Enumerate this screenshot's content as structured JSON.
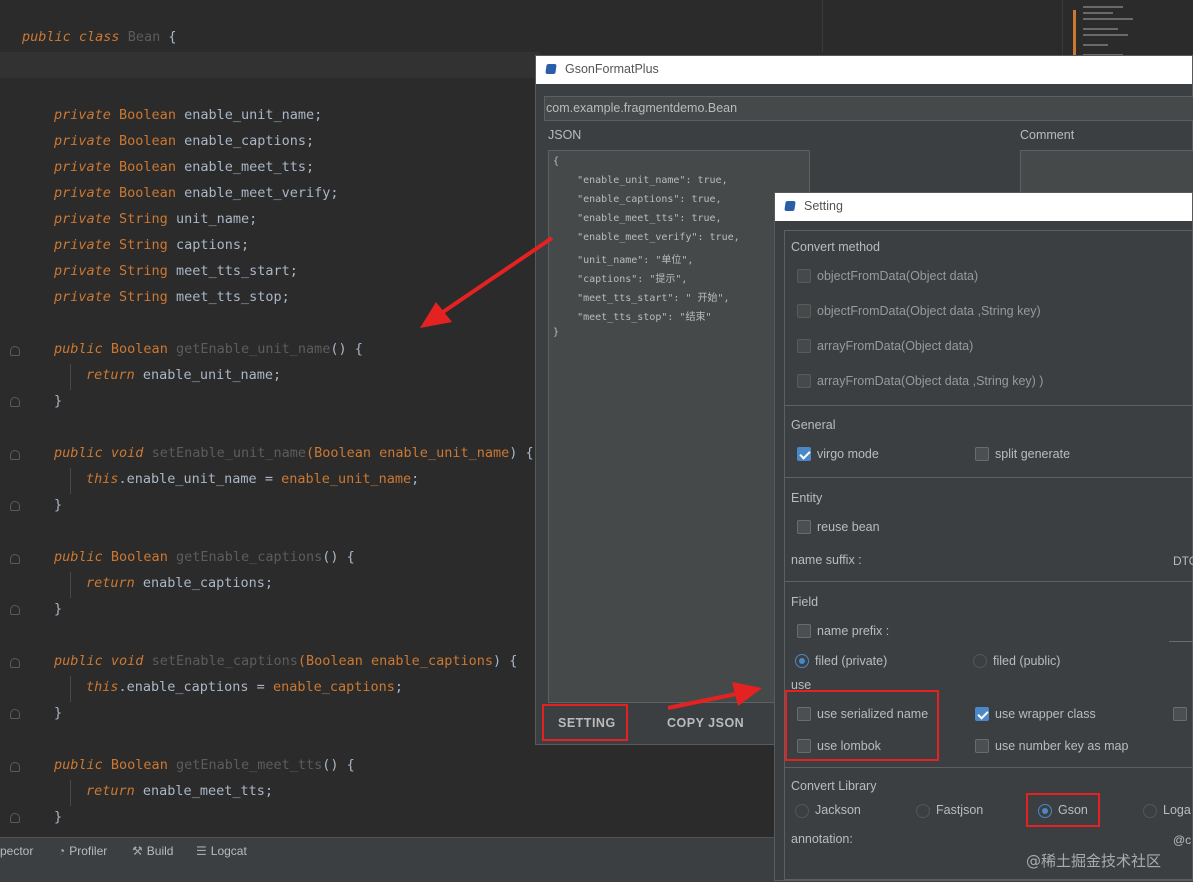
{
  "editor": {
    "class_line": {
      "kw1": "public",
      "kw2": "class",
      "name": "Bean",
      "brace": "{"
    },
    "fields": [
      {
        "mod": "private",
        "type": "Boolean",
        "name": "enable_unit_name;"
      },
      {
        "mod": "private",
        "type": "Boolean",
        "name": "enable_captions;"
      },
      {
        "mod": "private",
        "type": "Boolean",
        "name": "enable_meet_tts;"
      },
      {
        "mod": "private",
        "type": "Boolean",
        "name": "enable_meet_verify;"
      },
      {
        "mod": "private",
        "type": "String",
        "name": "unit_name;"
      },
      {
        "mod": "private",
        "type": "String",
        "name": "captions;"
      },
      {
        "mod": "private",
        "type": "String",
        "name": "meet_tts_start;"
      },
      {
        "mod": "private",
        "type": "String",
        "name": "meet_tts_stop;"
      }
    ],
    "m1": {
      "a": "public",
      "b": "Boolean",
      "c": "getEnable_unit_name",
      "d": "() {",
      "ret": "return",
      "retv": "enable_unit_name;",
      "close": "}"
    },
    "m2": {
      "a": "public",
      "b": "void",
      "c": "setEnable_unit_name",
      "d": "(Boolean ",
      "p": "enable_unit_name",
      "e": ") {",
      "t": "this",
      "f": ".enable_unit_name = ",
      "g": "enable_unit_name",
      "h": ";",
      "close": "}"
    },
    "m3": {
      "a": "public",
      "b": "Boolean",
      "c": "getEnable_captions",
      "d": "() {",
      "ret": "return",
      "retv": "enable_captions;",
      "close": "}"
    },
    "m4": {
      "a": "public",
      "b": "void",
      "c": "setEnable_captions",
      "d": "(Boolean ",
      "p": "enable_captions",
      "e": ") {",
      "t": "this",
      "f": ".enable_captions = ",
      "g": "enable_captions",
      "h": ";",
      "close": "}"
    },
    "m5": {
      "a": "public",
      "b": "Boolean",
      "c": "getEnable_meet_tts",
      "d": "() {",
      "ret": "return",
      "retv": "enable_meet_tts;",
      "close": "}"
    }
  },
  "statusbar": {
    "items": [
      "pector",
      "Profiler",
      "Build",
      "Logcat"
    ]
  },
  "gson": {
    "title": "GsonFormatPlus",
    "class_name": "com.example.fragmentdemo.Bean",
    "json_label": "JSON",
    "comment_label": "Comment",
    "json_lines": [
      "{",
      "    \"enable_unit_name\": true,",
      "    \"enable_captions\": true,",
      "    \"enable_meet_tts\": true,",
      "    \"enable_meet_verify\": true,",
      "    \"unit_name\": \"单位\",",
      "    \"captions\": \"提示\",",
      "    \"meet_tts_start\": \" 开始\",",
      "    \"meet_tts_stop\": \"结束\"",
      "}"
    ],
    "setting_btn": "SETTING",
    "copy_btn": "COPY  JSON"
  },
  "setting": {
    "title": "Setting",
    "convert_method": {
      "label": "Convert method",
      "options": [
        "objectFromData(Object data)",
        "objectFromData(Object data ,String key)",
        "arrayFromData(Object data)",
        "arrayFromData(Object data ,String key) )"
      ]
    },
    "general": {
      "label": "General",
      "virgo": "virgo mode",
      "split": "split generate"
    },
    "entity": {
      "label": "Entity",
      "reuse": "reuse bean",
      "suffix_label": "name suffix :",
      "suffix_value": "DTO"
    },
    "field": {
      "label": "Field",
      "prefix": "name prefix :",
      "private": "filed (private)",
      "public": "filed (public)"
    },
    "use": {
      "label": "use",
      "serialized": "use serialized name",
      "wrapper": "use wrapper class",
      "lombok": "use lombok",
      "number_key": "use number key as map"
    },
    "library": {
      "label": "Convert Library",
      "options": [
        "Jackson",
        "Fastjson",
        "Gson",
        "Loga"
      ],
      "annotation_label": "annotation:",
      "annotation_value": "@c"
    }
  },
  "watermark": "@稀土掘金技术社区"
}
